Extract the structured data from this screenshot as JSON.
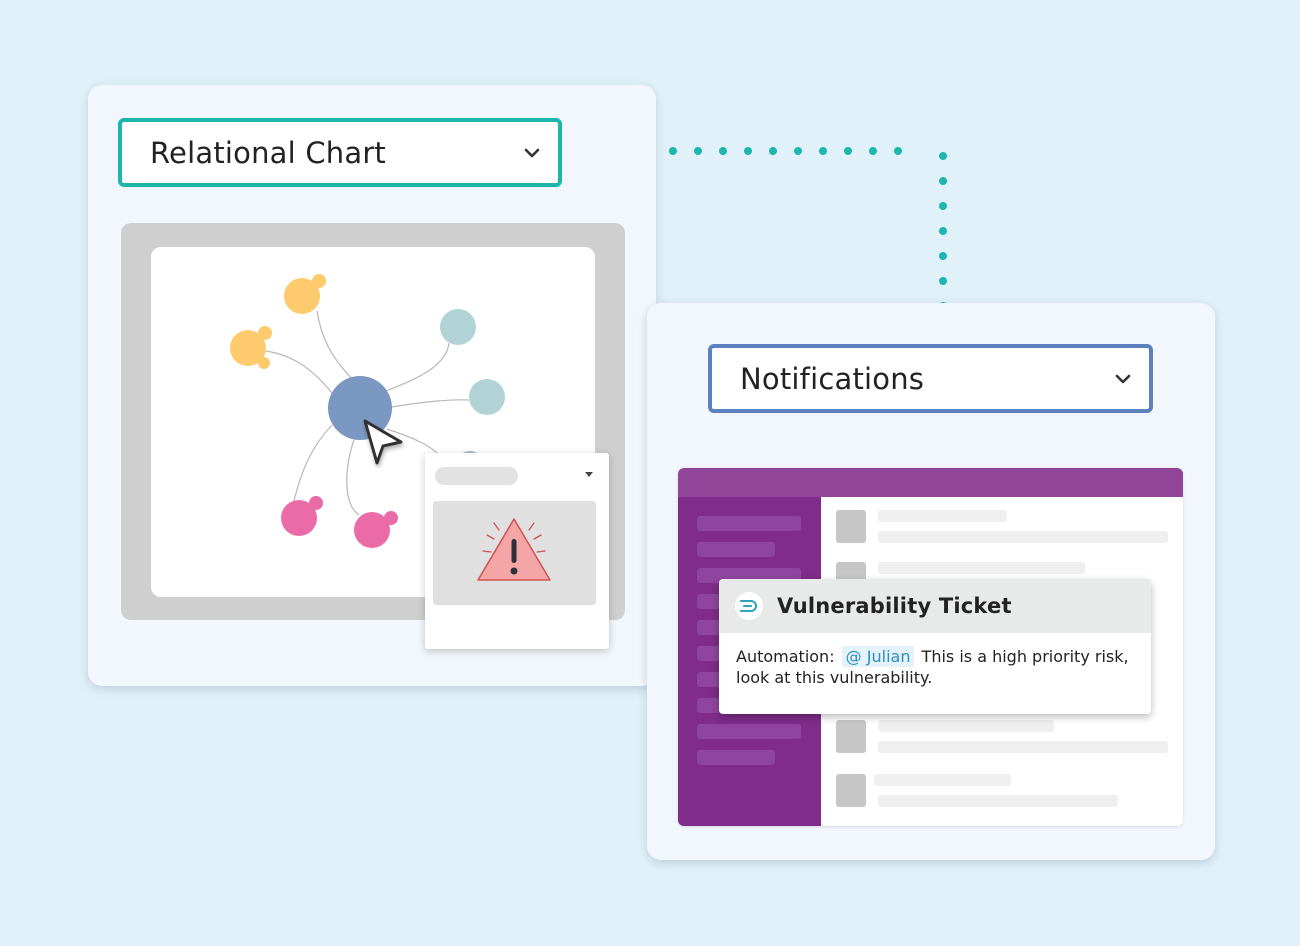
{
  "colors": {
    "background": "#e1f1f9",
    "card": "#f2f7fd",
    "teal_accent": "#1cb6ad",
    "blue_accent": "#5b82be",
    "slack_topbar": "#904598",
    "slack_sidebar": "#7f2c8a",
    "mention_bg": "#e3f2fb",
    "mention_text": "#2c8fc0"
  },
  "left_panel": {
    "select_label": "Relational Chart",
    "select_icon": "chevron-down-icon",
    "graph": {
      "center_node": {
        "color": "#7a98c1"
      },
      "nodes": [
        {
          "group": "yellow",
          "color": "#fdcb6e"
        },
        {
          "group": "yellow",
          "color": "#fdcb6e"
        },
        {
          "group": "teal",
          "color": "#b1d3d5"
        },
        {
          "group": "teal",
          "color": "#b1d3d5"
        },
        {
          "group": "teal",
          "color": "#9fc0c1"
        },
        {
          "group": "pink",
          "color": "#eb6ba9"
        },
        {
          "group": "pink",
          "color": "#eb6ba9"
        }
      ]
    },
    "popup": {
      "dropdown_icon": "caret-down-icon",
      "alert_icon": "warning-triangle-icon"
    }
  },
  "right_panel": {
    "select_label": "Notifications",
    "select_icon": "chevron-down-icon",
    "ticket": {
      "title": "Vulnerability Ticket",
      "logo_icon": "app-logo-icon",
      "prefix": "Automation:",
      "mention": "@ Julian",
      "message": "This is a high priority risk, look at this vulnerability."
    }
  }
}
